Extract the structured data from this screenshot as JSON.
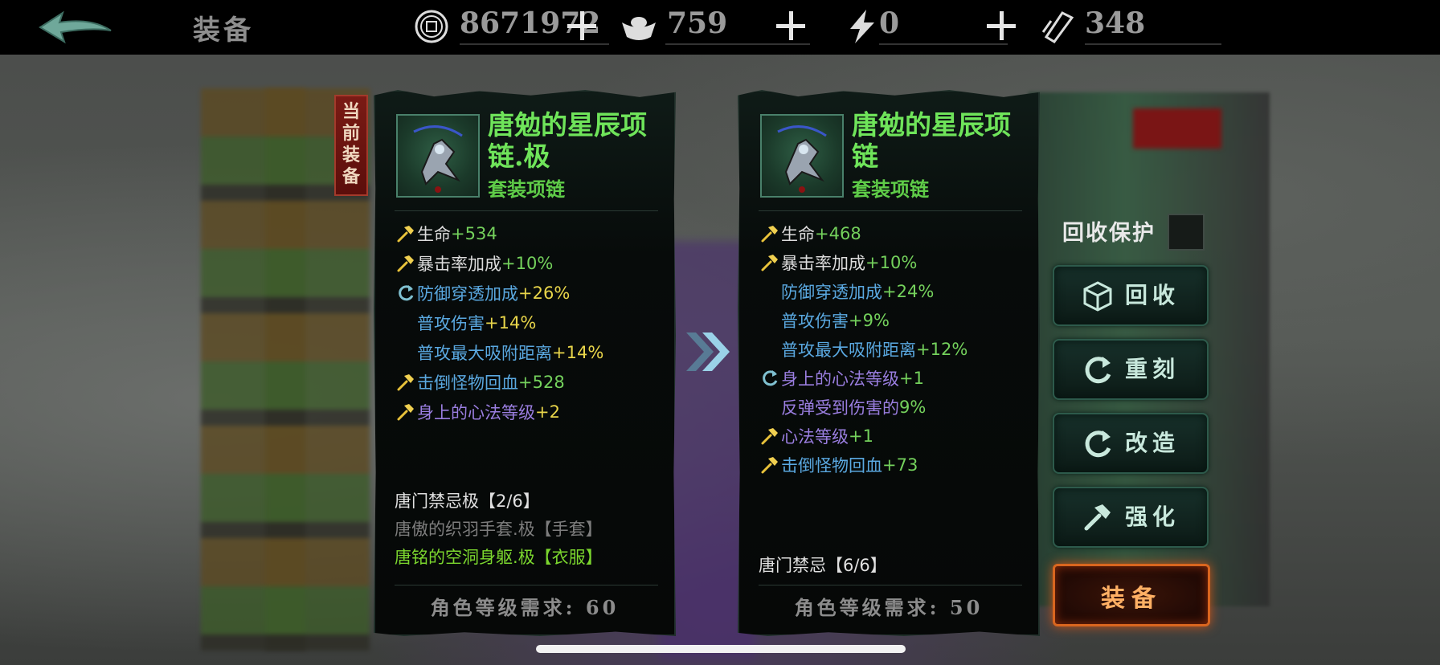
{
  "header": {
    "title": "装备",
    "resources": [
      {
        "icon": "coin-icon",
        "value": "8671972"
      },
      {
        "icon": "silver-ingot-icon",
        "value": "759"
      },
      {
        "icon": "lightning-icon",
        "value": "0"
      },
      {
        "icon": "ticket-icon",
        "value": "348"
      }
    ]
  },
  "current_tag": "当前装备",
  "current_item": {
    "name": "唐勉的星辰项链.极",
    "type": "套装项链",
    "attributes": [
      {
        "icon": "hammer",
        "name": "生命",
        "value": "+534",
        "name_color": "#dcdcdc",
        "value_color": "#74d15c"
      },
      {
        "icon": "hammer",
        "name": "暴击率加成",
        "value": "+10%",
        "name_color": "#dcdcdc",
        "value_color": "#74d15c"
      },
      {
        "icon": "refresh",
        "name": "防御穿透加成",
        "value": "+26%",
        "name_color": "#5aa8e0",
        "value_color": "#e8d54a"
      },
      {
        "icon": "",
        "name": "普攻伤害",
        "value": "+14%",
        "name_color": "#5aa8e0",
        "value_color": "#e8d54a"
      },
      {
        "icon": "",
        "name": "普攻最大吸附距离",
        "value": "+14%",
        "name_color": "#5aa8e0",
        "value_color": "#e8d54a"
      },
      {
        "icon": "hammer",
        "name": "击倒怪物回血",
        "value": "+528",
        "name_color": "#5aa8e0",
        "value_color": "#74d15c"
      },
      {
        "icon": "hammer",
        "name": "身上的心法等级",
        "value": "+2",
        "name_color": "#9a7ee0",
        "value_color": "#e8d54a"
      }
    ],
    "set_lines": [
      {
        "text": "唐门禁忌极【2/6】",
        "color": "#e0e0e0"
      },
      {
        "text": "唐傲的织羽手套.极【手套】",
        "color": "#7d7d7d"
      },
      {
        "text": "唐铭的空洞身躯.极【衣服】",
        "color": "#7bd62e"
      }
    ],
    "requirement": "角色等级需求: 60"
  },
  "new_item": {
    "name": "唐勉的星辰项链",
    "type": "套装项链",
    "attributes": [
      {
        "icon": "hammer",
        "name": "生命",
        "value": "+468",
        "name_color": "#dcdcdc",
        "value_color": "#74d15c"
      },
      {
        "icon": "hammer",
        "name": "暴击率加成",
        "value": "+10%",
        "name_color": "#dcdcdc",
        "value_color": "#74d15c"
      },
      {
        "icon": "",
        "name": "防御穿透加成",
        "value": "+24%",
        "name_color": "#5aa8e0",
        "value_color": "#74d15c"
      },
      {
        "icon": "",
        "name": "普攻伤害",
        "value": "+9%",
        "name_color": "#5aa8e0",
        "value_color": "#74d15c"
      },
      {
        "icon": "",
        "name": "普攻最大吸附距离",
        "value": "+12%",
        "name_color": "#5aa8e0",
        "value_color": "#74d15c"
      },
      {
        "icon": "refresh",
        "name": "身上的心法等级",
        "value": "+1",
        "name_color": "#9a7ee0",
        "value_color": "#74d15c"
      },
      {
        "icon": "",
        "name": "反弹受到伤害的",
        "value": "9%",
        "name_color": "#9a7ee0",
        "value_color": "#74d15c"
      },
      {
        "icon": "hammer",
        "name": "心法等级",
        "value": "+1",
        "name_color": "#9a7ee0",
        "value_color": "#74d15c"
      },
      {
        "icon": "hammer",
        "name": "击倒怪物回血",
        "value": "+73",
        "name_color": "#5aa8e0",
        "value_color": "#74d15c"
      }
    ],
    "set_lines": [
      {
        "text": "唐门禁忌【6/6】",
        "color": "#e0e0e0"
      }
    ],
    "requirement": "角色等级需求: 50"
  },
  "actions": {
    "protect_label": "回收保护",
    "recycle": "回收",
    "reforge": "重刻",
    "modify": "改造",
    "enhance": "强化",
    "equip": "装备"
  }
}
